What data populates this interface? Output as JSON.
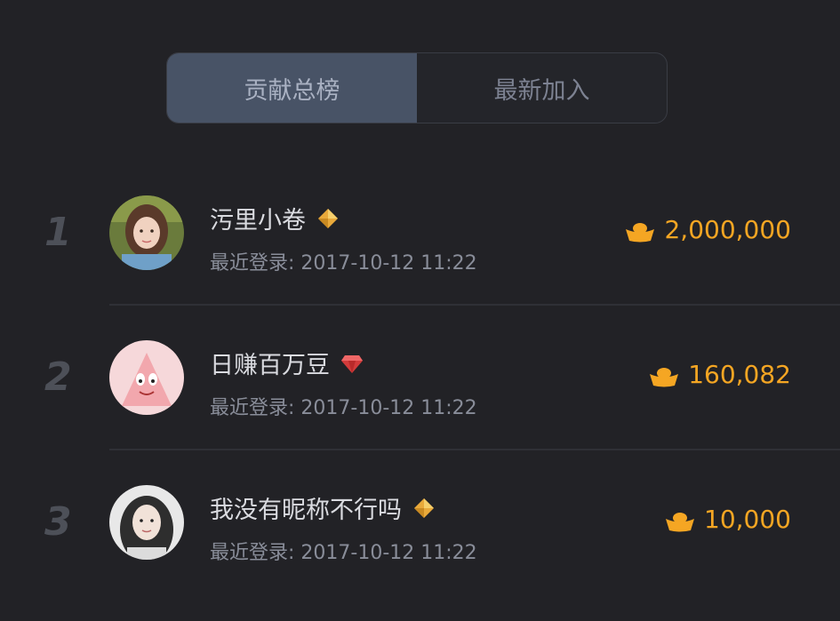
{
  "tabs": [
    {
      "label": "贡献总榜",
      "active": true
    },
    {
      "label": "最新加入",
      "active": false
    }
  ],
  "login_prefix": "最近登录:",
  "rows": [
    {
      "rank": "1",
      "name": "污里小卷",
      "badge": "diamond-icon",
      "login_time": "2017-10-12 11:22",
      "coins": "2,000,000"
    },
    {
      "rank": "2",
      "name": "日赚百万豆",
      "badge": "ruby-icon",
      "login_time": "2017-10-12 11:22",
      "coins": "160,082"
    },
    {
      "rank": "3",
      "name": "我没有昵称不行吗",
      "badge": "diamond-icon",
      "login_time": "2017-10-12 11:22",
      "coins": "10,000"
    }
  ],
  "colors": {
    "background": "#222226",
    "active_tab": "#485366",
    "coin": "#f5a623",
    "rank": "#4d5058"
  }
}
